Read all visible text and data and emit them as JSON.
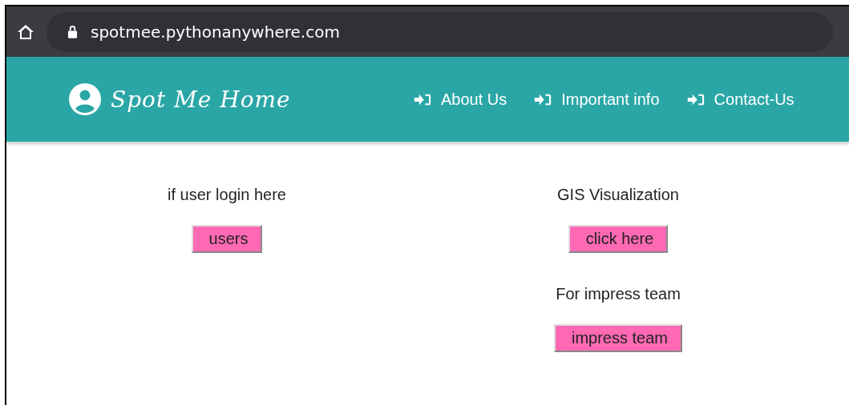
{
  "browser": {
    "url": "spotmee.pythonanywhere.com"
  },
  "header": {
    "brand": "Spot Me Home",
    "nav": [
      {
        "label": "About Us"
      },
      {
        "label": "Important info"
      },
      {
        "label": "Contact-Us"
      }
    ]
  },
  "columns": [
    [
      {
        "label": "if user login here",
        "button": "users"
      }
    ],
    [
      {
        "label": "GIS Visualization",
        "button": "click here"
      },
      {
        "label": "For impress team",
        "button": "impress team"
      }
    ]
  ]
}
